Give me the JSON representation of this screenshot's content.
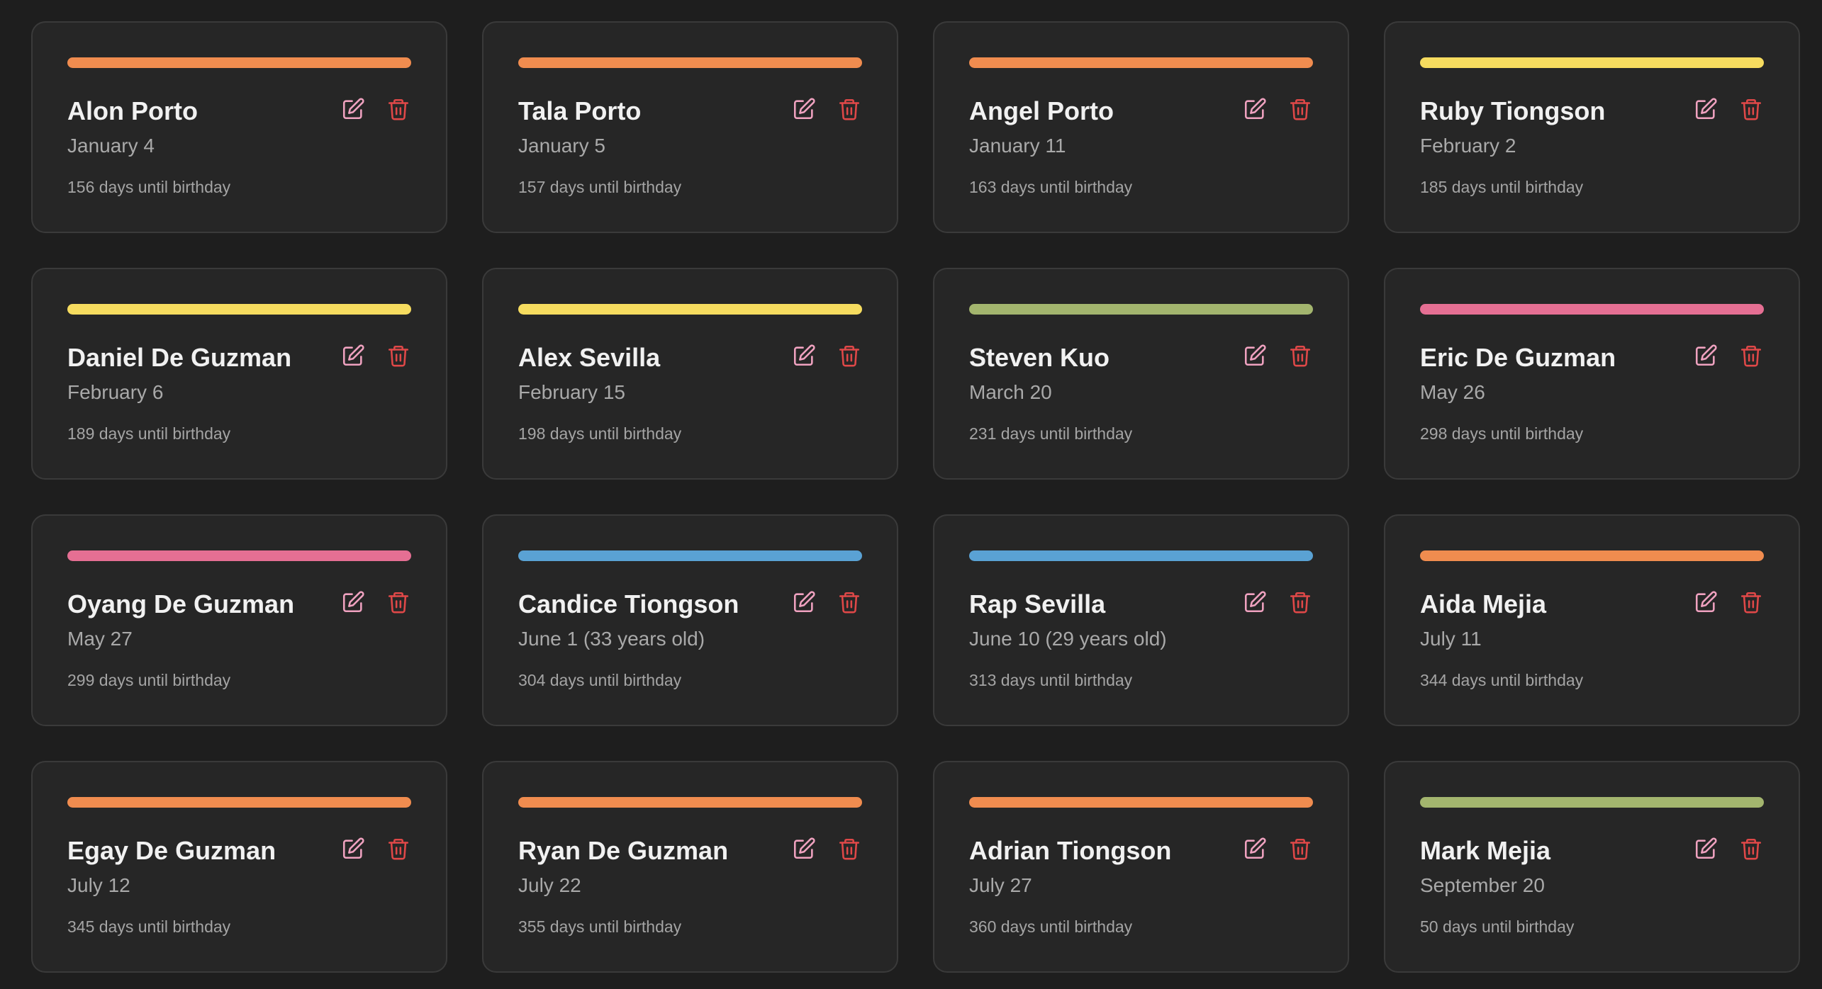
{
  "colors": {
    "orange": "#f08c4f",
    "yellow": "#f6dc5f",
    "green": "#a3b56e",
    "pink": "#e56f93",
    "blue": "#5aa2d4",
    "edit_icon": "#f0a2c0",
    "delete_icon": "#e04848"
  },
  "cards": [
    {
      "name": "Alon Porto",
      "date": "January 4",
      "countdown": "156 days until birthday",
      "accent": "#f08c4f"
    },
    {
      "name": "Tala Porto",
      "date": "January 5",
      "countdown": "157 days until birthday",
      "accent": "#f08c4f"
    },
    {
      "name": "Angel Porto",
      "date": "January 11",
      "countdown": "163 days until birthday",
      "accent": "#f08c4f"
    },
    {
      "name": "Ruby Tiongson",
      "date": "February 2",
      "countdown": "185 days until birthday",
      "accent": "#f6dc5f"
    },
    {
      "name": "Daniel De Guzman",
      "date": "February 6",
      "countdown": "189 days until birthday",
      "accent": "#f6dc5f"
    },
    {
      "name": "Alex Sevilla",
      "date": "February 15",
      "countdown": "198 days until birthday",
      "accent": "#f6dc5f"
    },
    {
      "name": "Steven Kuo",
      "date": "March 20",
      "countdown": "231 days until birthday",
      "accent": "#a3b56e"
    },
    {
      "name": "Eric De Guzman",
      "date": "May 26",
      "countdown": "298 days until birthday",
      "accent": "#e56f93"
    },
    {
      "name": "Oyang De Guzman",
      "date": "May 27",
      "countdown": "299 days until birthday",
      "accent": "#e56f93"
    },
    {
      "name": "Candice Tiongson",
      "date": "June 1 (33 years old)",
      "countdown": "304 days until birthday",
      "accent": "#5aa2d4"
    },
    {
      "name": "Rap Sevilla",
      "date": "June 10 (29 years old)",
      "countdown": "313 days until birthday",
      "accent": "#5aa2d4"
    },
    {
      "name": "Aida Mejia",
      "date": "July 11",
      "countdown": "344 days until birthday",
      "accent": "#f08c4f"
    },
    {
      "name": "Egay De Guzman",
      "date": "July 12",
      "countdown": "345 days until birthday",
      "accent": "#f08c4f"
    },
    {
      "name": "Ryan De Guzman",
      "date": "July 22",
      "countdown": "355 days until birthday",
      "accent": "#f08c4f"
    },
    {
      "name": "Adrian Tiongson",
      "date": "July 27",
      "countdown": "360 days until birthday",
      "accent": "#f08c4f"
    },
    {
      "name": "Mark Mejia",
      "date": "September 20",
      "countdown": "50 days until birthday",
      "accent": "#a3b56e"
    }
  ]
}
